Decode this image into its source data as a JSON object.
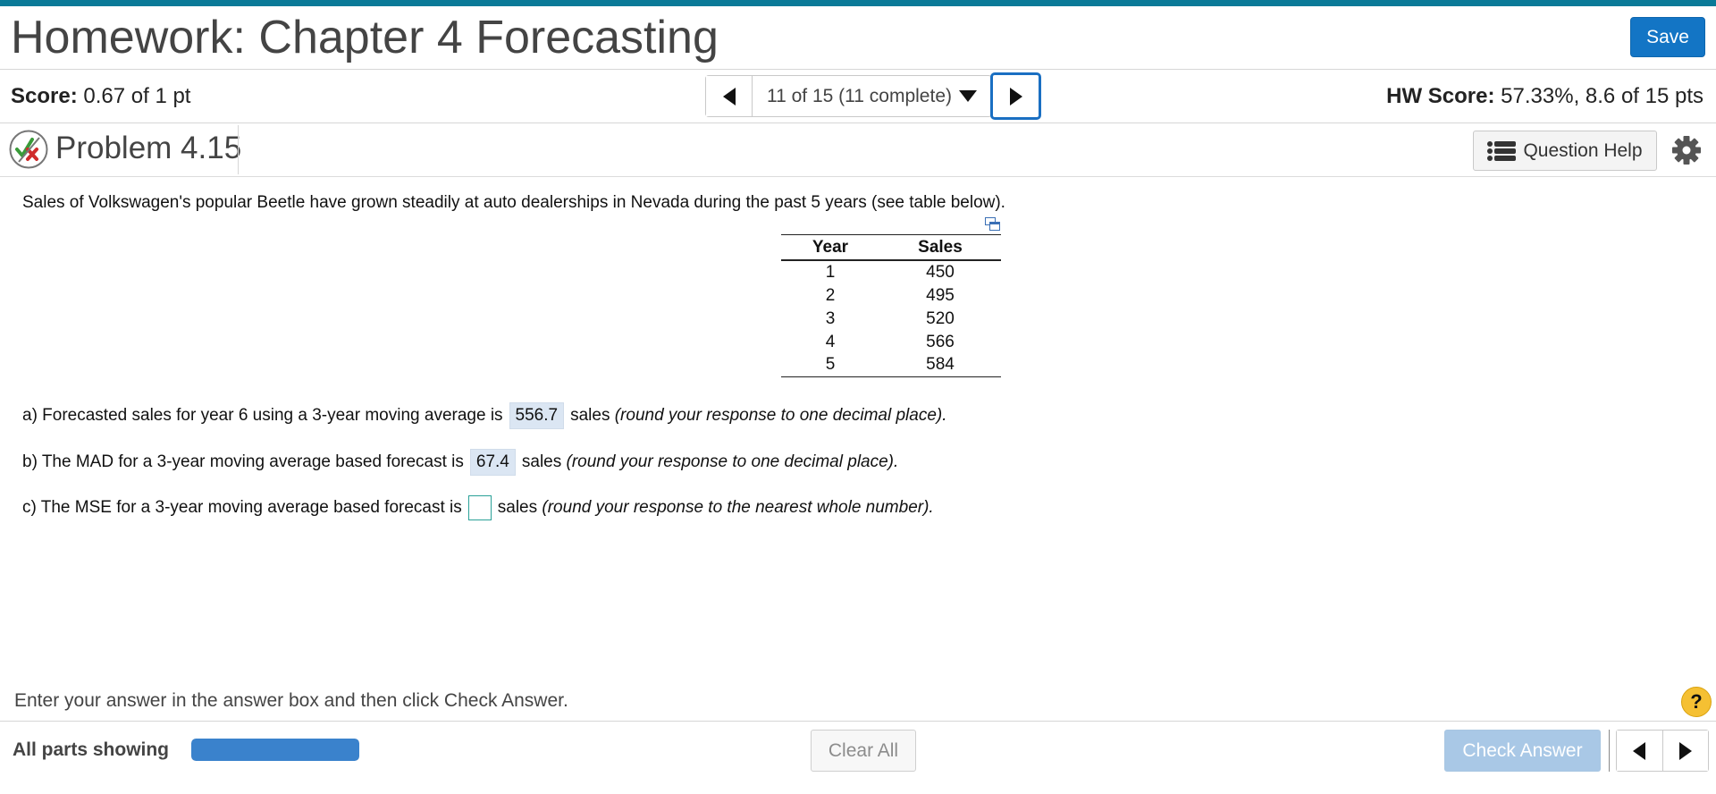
{
  "header": {
    "title": "Homework: Chapter 4 Forecasting",
    "save_label": "Save"
  },
  "score_bar": {
    "score_label": "Score:",
    "score_value": "0.67 of 1 pt",
    "question_nav": "11 of 15 (11 complete)",
    "hw_score_label": "HW Score:",
    "hw_score_value": "57.33%, 8.6 of 15 pts"
  },
  "problem": {
    "status_icon": "partial-credit-icon",
    "title": "Problem 4.15",
    "help_label": "Question Help",
    "help_icon": "list-icon",
    "settings_icon": "gear-icon"
  },
  "question": {
    "intro": "Sales of Volkswagen's popular Beetle have grown steadily at auto dealerships in Nevada during the past 5 years (see table below).",
    "table": {
      "headers": [
        "Year",
        "Sales"
      ],
      "rows": [
        [
          "1",
          "450"
        ],
        [
          "2",
          "495"
        ],
        [
          "3",
          "520"
        ],
        [
          "4",
          "566"
        ],
        [
          "5",
          "584"
        ]
      ]
    },
    "part_a": {
      "prefix": "a) Forecasted sales for year 6 using a 3-year moving average is",
      "answer": "556.7",
      "suffix": "sales",
      "note": "(round your response to one decimal place)."
    },
    "part_b": {
      "prefix": "b) The MAD for a 3-year moving average based forecast is",
      "answer": "67.4",
      "suffix": "sales",
      "note": "(round your response to one decimal place)."
    },
    "part_c": {
      "prefix": "c) The MSE for a 3-year moving average based forecast is",
      "answer": "",
      "suffix": "sales",
      "note": "(round your response to the nearest whole number)."
    }
  },
  "footer": {
    "instruction": "Enter your answer in the answer box and then click Check Answer.",
    "help_symbol": "?",
    "parts_label": "All parts showing",
    "progress_fraction": 1.0,
    "clear_label": "Clear All",
    "check_label": "Check Answer"
  },
  "colors": {
    "accent": "#0a7a98",
    "primary_button": "#1375c5",
    "answer_highlight": "#dbe6f3",
    "progress": "#3a82cc"
  }
}
